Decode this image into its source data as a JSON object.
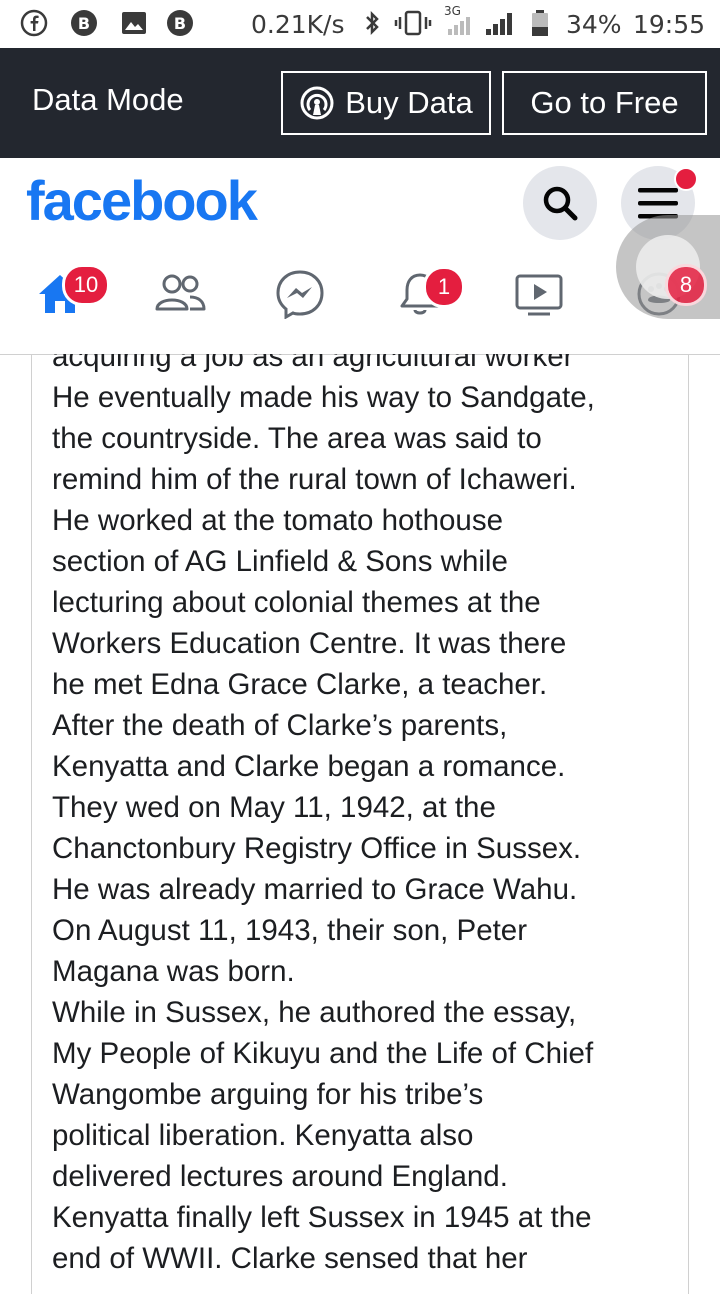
{
  "status_bar": {
    "speed": "0.21K/s",
    "network": "3G",
    "battery": "34%",
    "time": "19:55"
  },
  "data_bar": {
    "title": "Data Mode",
    "buy_label": "Buy Data",
    "free_label": "Go to Free"
  },
  "header": {
    "logo": "facebook"
  },
  "nav": {
    "home_badge": "10",
    "notifications_badge": "1",
    "marketplace_badge": "8"
  },
  "colors": {
    "brand": "#1877f2",
    "badge": "#e41e3f",
    "data_bar_bg": "#23272f"
  },
  "article": {
    "lines": [
      "acquiring a job as an agricultural worker",
      "He eventually made his way to Sandgate,",
      "the countryside. The area was said to",
      "remind him of the rural town of Ichaweri.",
      "He worked at the tomato hothouse",
      "section of AG Linfield & Sons while",
      "lecturing about colonial themes at the",
      "Workers Education Centre. It was there",
      "he met Edna Grace Clarke, a teacher.",
      "After the death of Clarke’s parents,",
      "Kenyatta and Clarke began a romance.",
      "They wed on May 11, 1942, at the",
      "Chanctonbury Registry Office in Sussex.",
      "He was already married to Grace Wahu.",
      "On August 11, 1943, their son, Peter",
      "Magana was born.",
      "While in Sussex, he authored the essay,",
      "My People of Kikuyu and the Life of Chief",
      "Wangombe arguing for his tribe’s",
      "political liberation. Kenyatta also",
      "delivered lectures around England.",
      "Kenyatta finally left Sussex in 1945 at the",
      "end of WWII. Clarke sensed that her"
    ]
  }
}
